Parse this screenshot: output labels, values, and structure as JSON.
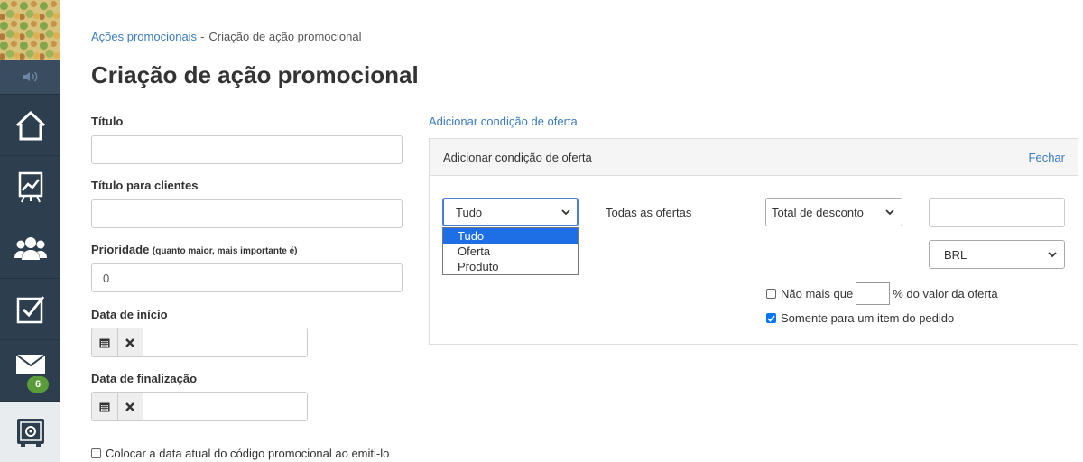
{
  "sidebar": {
    "badge_count": "6",
    "items": [
      {
        "icon": "home-icon"
      },
      {
        "icon": "chart-board-icon"
      },
      {
        "icon": "users-icon"
      },
      {
        "icon": "checkbox-icon"
      },
      {
        "icon": "mail-icon"
      },
      {
        "icon": "safe-icon",
        "active": true
      }
    ]
  },
  "breadcrumb": {
    "parent": "Ações promocionais",
    "separator": "-",
    "current": "Criação de ação promocional"
  },
  "page_title": "Criação de ação promocional",
  "form": {
    "title_label": "Título",
    "client_title_label": "Título para clientes",
    "priority_label": "Prioridade",
    "priority_hint": "(quanto maior, mais importante é)",
    "priority_value": "0",
    "start_date_label": "Data de início",
    "end_date_label": "Data de finalização",
    "current_date_checkbox_label": "Colocar a data atual do código promocional ao emiti-lo"
  },
  "offer": {
    "add_link": "Adicionar condição de oferta",
    "panel_title": "Adicionar condição de oferta",
    "close_label": "Fechar",
    "scope_select_value": "Tudo",
    "scope_options": [
      "Tudo",
      "Oferta",
      "Produto"
    ],
    "scope_highlighted": "Tudo",
    "all_offers_text": "Todas as ofertas",
    "discount_select_value": "Total de desconto",
    "currency_select_value": "BRL",
    "max_prefix": "Não mais que",
    "max_suffix": "% do valor da oferta",
    "only_one_item_label": "Somente para um item do pedido"
  },
  "colors": {
    "sidebar_bg": "#2d3e4f",
    "link": "#3b7cc0",
    "badge": "#5a9b3a",
    "highlight": "#1e6fe6"
  }
}
